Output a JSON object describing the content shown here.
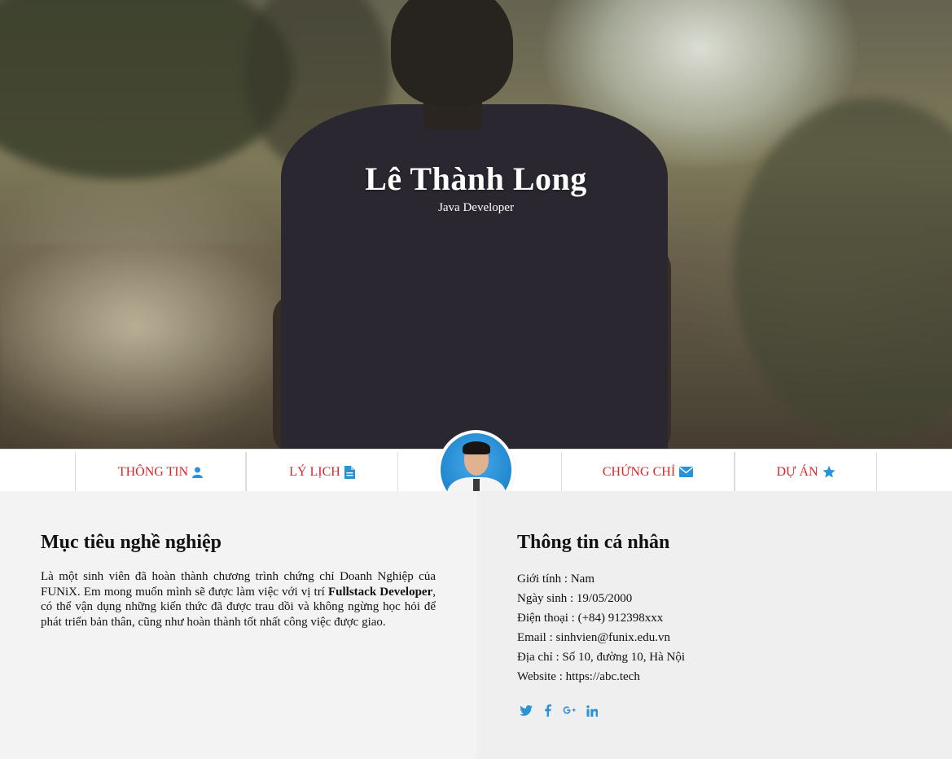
{
  "hero": {
    "name": "Lê Thành Long",
    "role": "Java Developer"
  },
  "nav": [
    {
      "label": "THÔNG TIN",
      "icon": "user-icon"
    },
    {
      "label": "LÝ LỊCH",
      "icon": "file-icon"
    },
    {
      "label": "CHỨNG CHỈ",
      "icon": "envelope-icon"
    },
    {
      "label": "DỰ ÁN",
      "icon": "star-icon"
    }
  ],
  "objective": {
    "title": "Mục tiêu nghề nghiệp",
    "text_before": "Là một sinh viên đã hoàn thành chương trình chứng chỉ Doanh Nghiệp của FUNiX. Em mong muốn mình sẽ được làm việc với vị trí ",
    "highlight": "Fullstack Developer",
    "text_after": ", có thể vận dụng những kiến thức đã được trau dồi và không ngừng học hỏi để phát triển bản thân, cũng như hoàn thành tốt nhất công việc được giao."
  },
  "personal": {
    "title": "Thông tin cá nhân",
    "rows": [
      "Giới tính : Nam",
      "Ngày sinh : 19/05/2000",
      "Điện thoại : (+84) 912398xxx",
      "Email : sinhvien@funix.edu.vn",
      "Địa chỉ : Số 10, đường 10, Hà Nội",
      "Website : https://abc.tech"
    ],
    "socials": [
      "twitter-icon",
      "facebook-icon",
      "google-plus-icon",
      "linkedin-icon"
    ]
  },
  "colors": {
    "accent_red": "#d9242b",
    "icon_blue": "#2a93d5"
  }
}
